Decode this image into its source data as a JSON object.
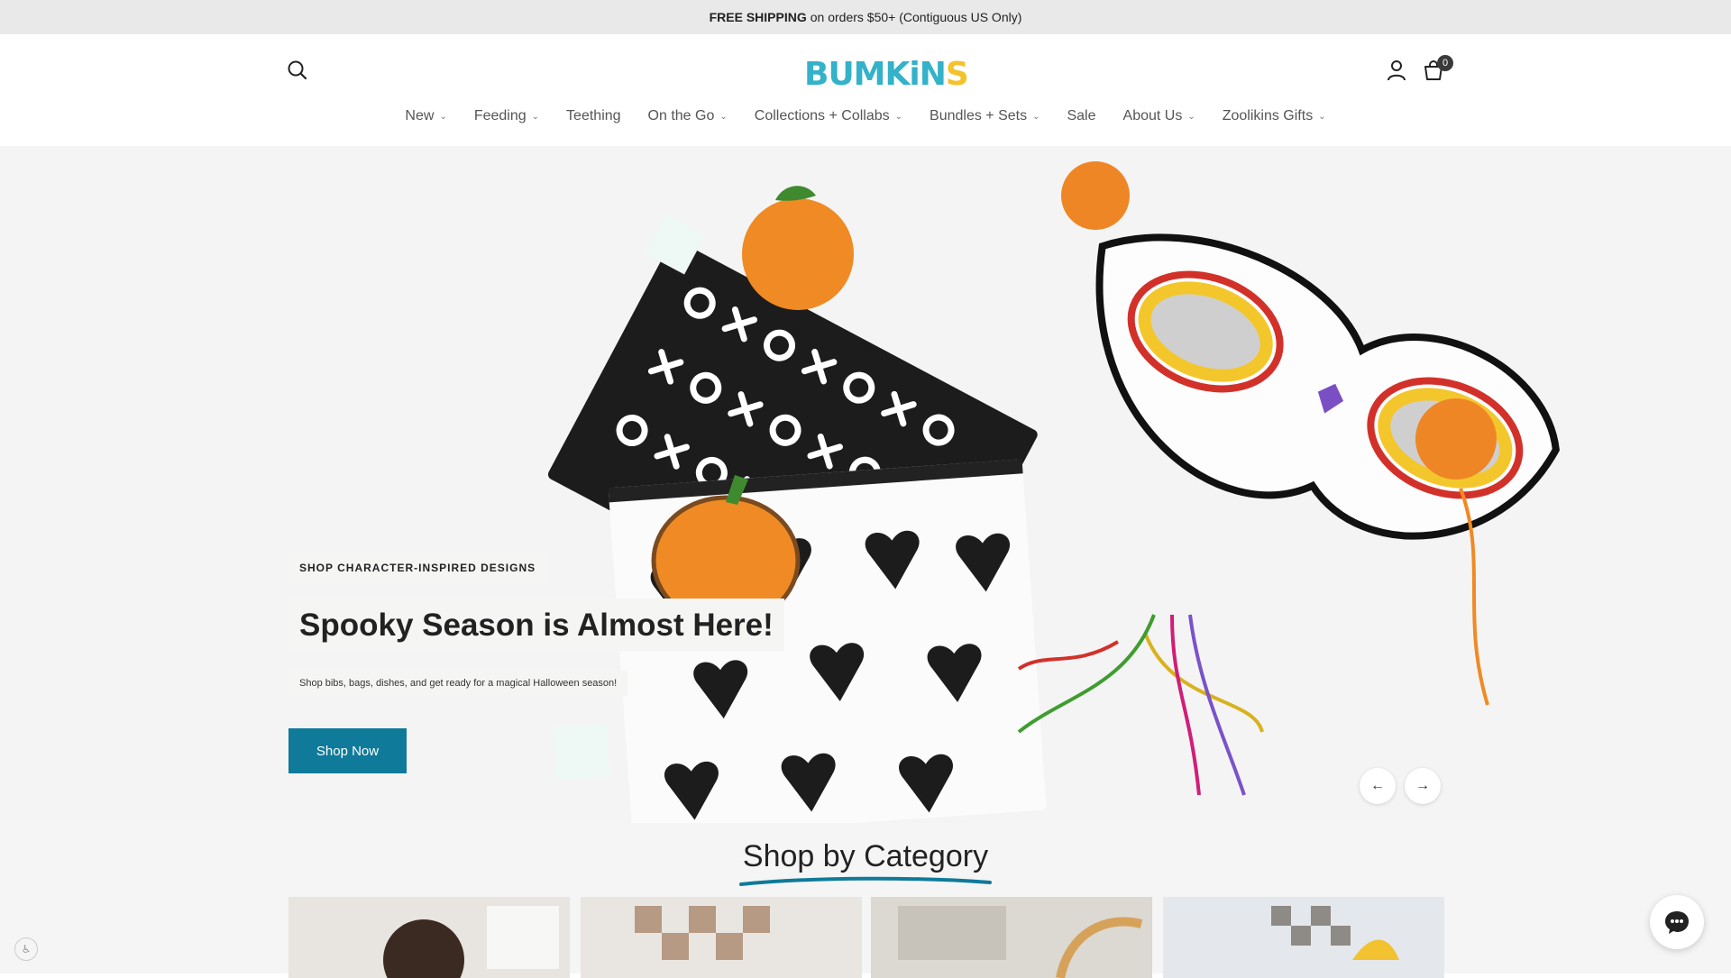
{
  "announcement": {
    "bold": "FREE SHIPPING",
    "rest": "on orders $50+ (Contiguous US Only)"
  },
  "header": {
    "logo_main": "BUMKiN",
    "logo_end": "S",
    "cart_count": "0",
    "icons": {
      "search": "search-icon",
      "account": "user-icon",
      "cart": "cart-icon"
    }
  },
  "nav": [
    {
      "label": "New",
      "dropdown": true
    },
    {
      "label": "Feeding",
      "dropdown": true
    },
    {
      "label": "Teething",
      "dropdown": false
    },
    {
      "label": "On the Go",
      "dropdown": true
    },
    {
      "label": "Collections + Collabs",
      "dropdown": true
    },
    {
      "label": "Bundles + Sets",
      "dropdown": true
    },
    {
      "label": "Sale",
      "dropdown": false
    },
    {
      "label": "About Us",
      "dropdown": true
    },
    {
      "label": "Zoolikins Gifts",
      "dropdown": true
    }
  ],
  "hero": {
    "eyebrow": "SHOP CHARACTER-INSPIRED DESIGNS",
    "headline": "Spooky Season is Almost Here!",
    "subtext": "Shop bibs, bags, dishes, and get ready for a magical Halloween season!",
    "cta": "Shop Now",
    "prev_icon": "arrow-left-icon",
    "next_icon": "arrow-right-icon"
  },
  "category": {
    "title": "Shop by Category"
  },
  "colors": {
    "brand": "#33b2c9",
    "accent_yellow": "#f4c22b",
    "cta": "#0f7a9a",
    "announce_bg": "#e9e9ea"
  }
}
